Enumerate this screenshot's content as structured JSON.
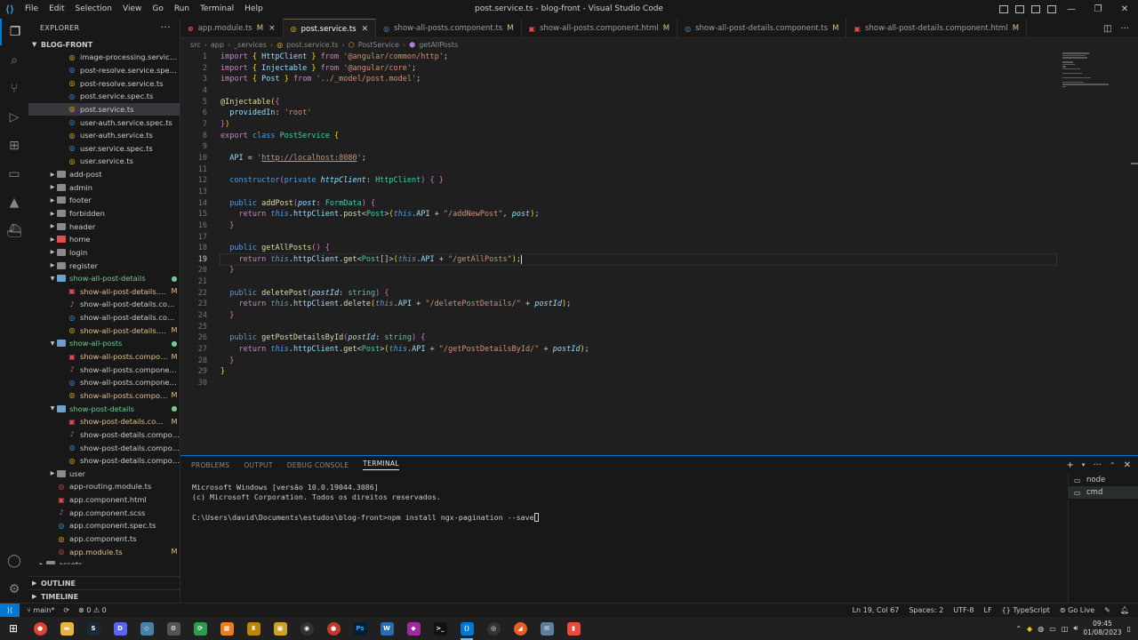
{
  "window": {
    "title": "post.service.ts - blog-front - Visual Studio Code",
    "menu": [
      "File",
      "Edit",
      "Selection",
      "View",
      "Go",
      "Run",
      "Terminal",
      "Help"
    ]
  },
  "explorer": {
    "header": "EXPLORER",
    "root": "BLOG-FRONT",
    "tree": [
      {
        "name": "image-processing.service.ts",
        "depth": 3,
        "kind": "ts",
        "status": ""
      },
      {
        "name": "post-resolve.service.spec.ts",
        "depth": 3,
        "kind": "spec",
        "status": ""
      },
      {
        "name": "post-resolve.service.ts",
        "depth": 3,
        "kind": "ts",
        "status": ""
      },
      {
        "name": "post.service.spec.ts",
        "depth": 3,
        "kind": "spec",
        "status": ""
      },
      {
        "name": "post.service.ts",
        "depth": 3,
        "kind": "ts",
        "status": "",
        "selected": true
      },
      {
        "name": "user-auth.service.spec.ts",
        "depth": 3,
        "kind": "spec",
        "status": ""
      },
      {
        "name": "user-auth.service.ts",
        "depth": 3,
        "kind": "ts",
        "status": ""
      },
      {
        "name": "user.service.spec.ts",
        "depth": 3,
        "kind": "spec",
        "status": ""
      },
      {
        "name": "user.service.ts",
        "depth": 3,
        "kind": "ts",
        "status": ""
      },
      {
        "name": "add-post",
        "depth": 2,
        "kind": "folder",
        "status": ""
      },
      {
        "name": "admin",
        "depth": 2,
        "kind": "folder",
        "status": ""
      },
      {
        "name": "footer",
        "depth": 2,
        "kind": "folder",
        "status": ""
      },
      {
        "name": "forbidden",
        "depth": 2,
        "kind": "folder",
        "status": ""
      },
      {
        "name": "header",
        "depth": 2,
        "kind": "folder",
        "status": ""
      },
      {
        "name": "home",
        "depth": 2,
        "kind": "folder-red",
        "status": ""
      },
      {
        "name": "login",
        "depth": 2,
        "kind": "folder",
        "status": ""
      },
      {
        "name": "register",
        "depth": 2,
        "kind": "folder",
        "status": ""
      },
      {
        "name": "show-all-post-details",
        "depth": 2,
        "kind": "folder-open",
        "status": "dot"
      },
      {
        "name": "show-all-post-details.c...",
        "depth": 3,
        "kind": "html",
        "status": "M"
      },
      {
        "name": "show-all-post-details.compo...",
        "depth": 3,
        "kind": "scss",
        "status": ""
      },
      {
        "name": "show-all-post-details.compo...",
        "depth": 3,
        "kind": "spec",
        "status": ""
      },
      {
        "name": "show-all-post-details.c...",
        "depth": 3,
        "kind": "ts",
        "status": "M"
      },
      {
        "name": "show-all-posts",
        "depth": 2,
        "kind": "folder-open",
        "status": "dot"
      },
      {
        "name": "show-all-posts.compon...",
        "depth": 3,
        "kind": "html",
        "status": "M"
      },
      {
        "name": "show-all-posts.component.s...",
        "depth": 3,
        "kind": "scss",
        "status": ""
      },
      {
        "name": "show-all-posts.component.s...",
        "depth": 3,
        "kind": "spec",
        "status": ""
      },
      {
        "name": "show-all-posts.compon...",
        "depth": 3,
        "kind": "ts",
        "status": "M"
      },
      {
        "name": "show-post-details",
        "depth": 2,
        "kind": "folder-open",
        "status": "dot"
      },
      {
        "name": "show-post-details.com...",
        "depth": 3,
        "kind": "html",
        "status": "M"
      },
      {
        "name": "show-post-details.compone...",
        "depth": 3,
        "kind": "scss",
        "status": ""
      },
      {
        "name": "show-post-details.compone...",
        "depth": 3,
        "kind": "spec",
        "status": ""
      },
      {
        "name": "show-post-details.compone...",
        "depth": 3,
        "kind": "ts",
        "status": ""
      },
      {
        "name": "user",
        "depth": 2,
        "kind": "folder",
        "status": ""
      },
      {
        "name": "app-routing.module.ts",
        "depth": 2,
        "kind": "ts-red",
        "status": ""
      },
      {
        "name": "app.component.html",
        "depth": 2,
        "kind": "html",
        "status": ""
      },
      {
        "name": "app.component.scss",
        "depth": 2,
        "kind": "scss",
        "status": ""
      },
      {
        "name": "app.component.spec.ts",
        "depth": 2,
        "kind": "spec",
        "status": ""
      },
      {
        "name": "app.component.ts",
        "depth": 2,
        "kind": "ts",
        "status": ""
      },
      {
        "name": "app.module.ts",
        "depth": 2,
        "kind": "ts-red",
        "status": "M"
      },
      {
        "name": "assets",
        "depth": 1,
        "kind": "folder",
        "status": ""
      }
    ],
    "outline": "OUTLINE",
    "timeline": "TIMELINE"
  },
  "tabs": [
    {
      "label": "app.module.ts",
      "status": "M",
      "icon": "angular-module-icon",
      "active": false
    },
    {
      "label": "post.service.ts",
      "status": "",
      "icon": "angular-service-icon",
      "active": true
    },
    {
      "label": "show-all-posts.component.ts",
      "status": "M",
      "icon": "angular-component-icon",
      "active": false
    },
    {
      "label": "show-all-posts.component.html",
      "status": "M",
      "icon": "html-icon",
      "active": false
    },
    {
      "label": "show-all-post-details.component.ts",
      "status": "M",
      "icon": "angular-component-icon",
      "active": false
    },
    {
      "label": "show-all-post-details.component.html",
      "status": "M",
      "icon": "html-icon",
      "active": false
    }
  ],
  "breadcrumb": [
    "src",
    "app",
    "_services",
    "post.service.ts",
    "PostService",
    "getAllPosts"
  ],
  "editor": {
    "current_line": 19,
    "line_numbers": [
      "1",
      "2",
      "3",
      "4",
      "5",
      "6",
      "7",
      "8",
      "9",
      "10",
      "11",
      "12",
      "13",
      "14",
      "15",
      "16",
      "17",
      "18",
      "19",
      "20",
      "21",
      "22",
      "23",
      "24",
      "25",
      "26",
      "27",
      "28",
      "29",
      "30"
    ]
  },
  "panel": {
    "tabs": [
      "PROBLEMS",
      "OUTPUT",
      "DEBUG CONSOLE",
      "TERMINAL"
    ],
    "active_tab": "TERMINAL",
    "terminal_lines": [
      "Microsoft Windows [versão 10.0.19044.3086]",
      "(c) Microsoft Corporation. Todos os direitos reservados.",
      "",
      "C:\\Users\\david\\Documents\\estudos\\blog-front>npm install ngx-pagination --save"
    ],
    "terminals": [
      "node",
      "cmd"
    ]
  },
  "statusbar": {
    "branch": "main*",
    "errors": "0",
    "warnings": "0",
    "position": "Ln 19, Col 67",
    "spaces": "Spaces: 2",
    "encoding": "UTF-8",
    "eol": "LF",
    "language": "TypeScript",
    "golive": "Go Live"
  },
  "taskbar": {
    "time": "09:45",
    "date": "01/08/2023"
  }
}
